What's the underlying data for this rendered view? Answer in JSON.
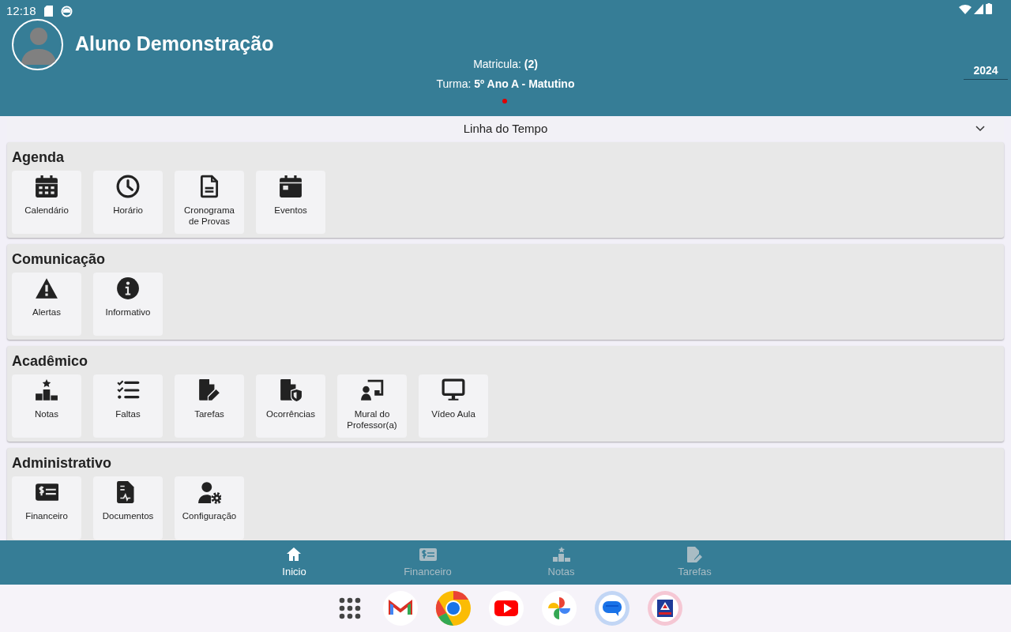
{
  "status_bar": {
    "time": "12:18"
  },
  "profile": {
    "name": "Aluno Demonstração",
    "enrollment": "Matricula: **(2)**",
    "class": "Turma: **5º Ano A - Matutino**",
    "year": "2024"
  },
  "timeline": {
    "label": "Linha do Tempo",
    "expanded": false
  },
  "sections": [
    {
      "title": "Agenda",
      "tiles": [
        "Calendário",
        "Horário",
        "Cronograma de Provas",
        "Eventos"
      ]
    },
    {
      "title": "Comunicação",
      "tiles": [
        "Alertas",
        "Informativo"
      ]
    },
    {
      "title": "Acadêmico",
      "tiles": [
        "Notas",
        "Faltas",
        "Tarefas",
        "Ocorrências",
        "Mural do Professor(a)",
        "Vídeo Aula"
      ]
    },
    {
      "title": "Administrativo",
      "tiles": [
        "Financeiro",
        "Documentos",
        "Configuração"
      ]
    }
  ],
  "bottom_nav": [
    {
      "label": "Inicio",
      "selected": true
    },
    {
      "label": "Financeiro",
      "selected": false
    },
    {
      "label": "Notas",
      "selected": false
    },
    {
      "label": "Tarefas",
      "selected": false
    }
  ]
}
